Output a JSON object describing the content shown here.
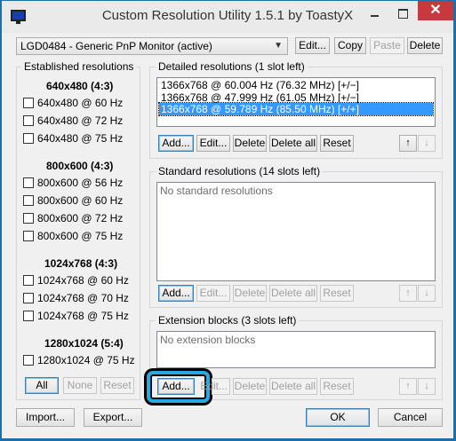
{
  "titlebar": {
    "title": "Custom Resolution Utility 1.5.1 by ToastyX",
    "close_glyph": "✕"
  },
  "monitor": {
    "selected": "LGD0484 - Generic PnP Monitor (active)",
    "buttons": {
      "edit": "Edit...",
      "copy": "Copy",
      "paste": "Paste",
      "delete": "Delete"
    }
  },
  "established": {
    "label": "Established resolutions",
    "groups": [
      {
        "title": "640x480 (4:3)",
        "items": [
          "640x480 @ 60 Hz",
          "640x480 @ 72 Hz",
          "640x480 @ 75 Hz"
        ]
      },
      {
        "title": "800x600 (4:3)",
        "items": [
          "800x600 @ 56 Hz",
          "800x600 @ 60 Hz",
          "800x600 @ 72 Hz",
          "800x600 @ 75 Hz"
        ]
      },
      {
        "title": "1024x768 (4:3)",
        "items": [
          "1024x768 @ 60 Hz",
          "1024x768 @ 70 Hz",
          "1024x768 @ 75 Hz"
        ]
      },
      {
        "title": "1280x1024 (5:4)",
        "items": [
          "1280x1024 @ 75 Hz"
        ]
      }
    ],
    "buttons": {
      "all": "All",
      "none": "None",
      "reset": "Reset"
    }
  },
  "detailed": {
    "label": "Detailed resolutions (1 slot left)",
    "items": [
      "1366x768 @ 60.004 Hz (76.32 MHz) [+/−]",
      "1366x768 @ 47.999 Hz (61.05 MHz) [+/−]",
      "1366x768 @ 59.789 Hz (85.50 MHz) [+/+]"
    ],
    "buttons": {
      "add": "Add...",
      "edit": "Edit...",
      "delete": "Delete",
      "delete_all": "Delete all",
      "reset": "Reset"
    }
  },
  "standard": {
    "label": "Standard resolutions (14 slots left)",
    "empty": "No standard resolutions",
    "buttons": {
      "add": "Add...",
      "edit": "Edit...",
      "delete": "Delete",
      "delete_all": "Delete all",
      "reset": "Reset"
    }
  },
  "extension": {
    "label": "Extension blocks (3 slots left)",
    "empty": "No extension blocks",
    "buttons": {
      "add": "Add...",
      "edit": "Edit...",
      "delete": "Delete",
      "delete_all": "Delete all",
      "reset": "Reset"
    }
  },
  "footer": {
    "import": "Import...",
    "export": "Export...",
    "ok": "OK",
    "cancel": "Cancel"
  },
  "arrows": {
    "up": "↑",
    "down": "↓"
  },
  "colors": {
    "selection": "#3399ff",
    "highlight": "#2aa8df",
    "close": "#c7383f"
  }
}
